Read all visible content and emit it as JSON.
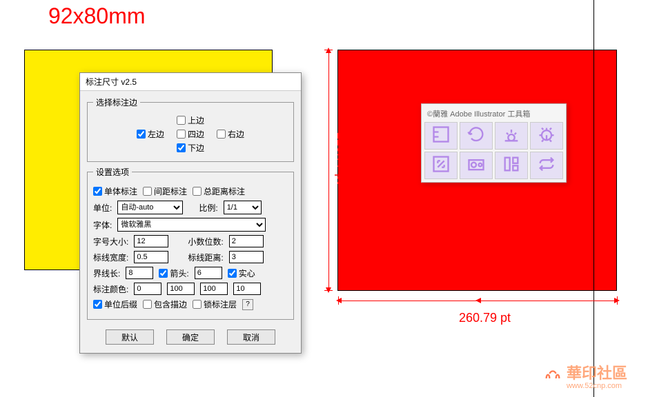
{
  "size_label": "92x80mm",
  "dimensions": {
    "vertical": "226.77 pt",
    "horizontal": "260.79 pt"
  },
  "dialog": {
    "title": "标注尺寸 v2.5",
    "group_edges": {
      "legend": "选择标注边",
      "top": "上边",
      "left": "左边",
      "all": "四边",
      "right": "右边",
      "bottom": "下边",
      "checked_left": true,
      "checked_bottom": true
    },
    "group_options": {
      "legend": "设置选项",
      "single": "单体标注",
      "spacing": "间距标注",
      "total": "总距离标注",
      "unit_label": "单位:",
      "unit_value": "自动-auto",
      "ratio_label": "比例:",
      "ratio_value": "1/1",
      "font_label": "字体:",
      "font_value": "微软雅黑",
      "fontsize_label": "字号大小:",
      "fontsize_value": "12",
      "decimal_label": "小数位数:",
      "decimal_value": "2",
      "linewidth_label": "标线宽度:",
      "linewidth_value": "0.5",
      "linedist_label": "标线距离:",
      "linedist_value": "3",
      "boundary_label": "界线长:",
      "boundary_value": "8",
      "arrow_label": "箭头:",
      "arrow_value": "6",
      "solid_label": "实心",
      "color_label": "标注颜色:",
      "color_c": "0",
      "color_m": "100",
      "color_y": "100",
      "color_k": "10",
      "suffix_label": "单位后缀",
      "stroke_label": "包含描边",
      "lock_label": "锁标注层",
      "help": "?"
    },
    "buttons": {
      "default": "默认",
      "ok": "确定",
      "cancel": "取消"
    }
  },
  "toolbox": {
    "title": "©蘭雅 Adobe Illustrator 工具箱"
  },
  "watermark": {
    "main": "華印社區",
    "sub": "www.52cnp.com"
  }
}
